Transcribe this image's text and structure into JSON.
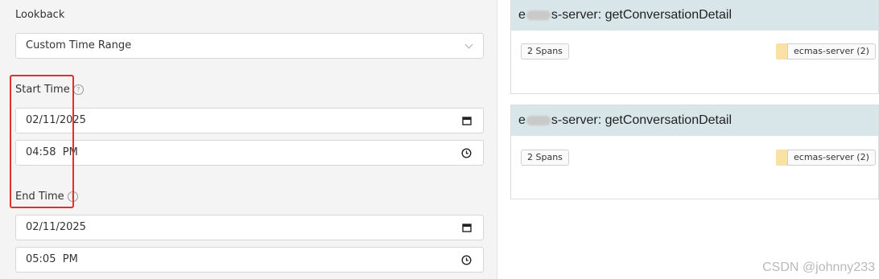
{
  "lookback": {
    "label": "Lookback",
    "selected": "Custom Time Range"
  },
  "start_time": {
    "label": "Start Time",
    "date": "02/11/2025",
    "time": "04:58  PM"
  },
  "end_time": {
    "label": "End Time",
    "date": "02/11/2025",
    "time": "05:05  PM"
  },
  "help_glyph": "?",
  "traces": [
    {
      "title_prefix": "e",
      "title_suffix": "s-server: getConversationDetail",
      "spans": "2 Spans",
      "service": "ecmas-server (2)"
    },
    {
      "title_prefix": "e",
      "title_suffix": "s-server: getConversationDetail",
      "spans": "2 Spans",
      "service": "ecmas-server (2)"
    }
  ],
  "watermark": "CSDN @johnny233",
  "colors": {
    "highlight": "#e0302b",
    "trace_header": "#d8e6e9",
    "service_swatch": "#f9e1a6"
  }
}
